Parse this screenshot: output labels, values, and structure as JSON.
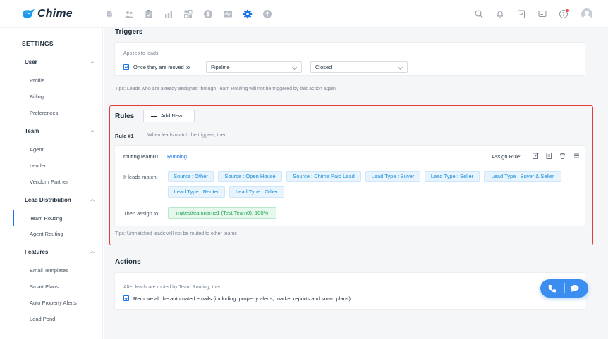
{
  "brand": {
    "name": "Chime",
    "color": "#1a9bf0"
  },
  "top_nav": {
    "icons": [
      "bell-alert-icon",
      "people-icon",
      "clipboard-check-icon",
      "bar-chart-icon",
      "grid-layout-icon",
      "dollar-icon",
      "pulse-monitor-icon",
      "gear-icon",
      "upload-circle-icon"
    ],
    "active_icon": "gear-icon",
    "accent": "#1a73e8"
  },
  "top_right": {
    "icons": [
      "search-icon",
      "bell-icon",
      "task-check-icon",
      "message-icon",
      "help-icon",
      "avatar"
    ]
  },
  "sidebar": {
    "title": "SETTINGS",
    "groups": [
      {
        "label": "User",
        "items": [
          "Profile",
          "Billing",
          "Preferences"
        ]
      },
      {
        "label": "Team",
        "items": [
          "Agent",
          "Lender",
          "Vendor / Partner"
        ]
      },
      {
        "label": "Lead Distribution",
        "items": [
          "Team Routing",
          "Agent Routing"
        ]
      },
      {
        "label": "Features",
        "items": [
          "Email Templates",
          "Smart Plans",
          "Auto Property Alerts",
          "Lead Pond"
        ]
      }
    ],
    "active_item": "Team Routing"
  },
  "triggers": {
    "title": "Triggers",
    "applies_label": "Applies to leads:",
    "checkbox_label": "Once they are moved to",
    "select_1": "Pipeline",
    "select_2": "Closed",
    "tip": "Tips: Leads who are already assigned through Team Routing will not be triggered by this action again"
  },
  "rules": {
    "title": "Rules",
    "add_label": "Add New",
    "rule_label": "Rule #1",
    "rule_desc": "When leads match the triggers, then:",
    "routing_name": "routing team01",
    "routing_status": "Running",
    "assign_rule_label": "Assign Rule:",
    "match_label": "If leads match:",
    "tags": [
      "Source : Other",
      "Source : Open House",
      "Source : Chime Paid Lead",
      "Lead Type : Buyer",
      "Lead Type : Seller",
      "Lead Type : Buyer & Seller",
      "Lead Type : Renter",
      "Lead Type : Other"
    ],
    "assign_label": "Then assign to:",
    "assignee": "mytestteamname1 (Test Team0): 100%",
    "tip": "Tips: Unmatched leads will not be routed to other teams"
  },
  "actions": {
    "title": "Actions",
    "desc": "After leads are routed by Team Routing, then:",
    "checkbox_label": "Remove all the automated emails (including: property alerts, market reports and smart plans)"
  },
  "colors": {
    "highlight_border": "#e63a3a",
    "tag_blue": "#1a8fd8",
    "tag_green": "#23a35a",
    "float_button": "#3b8ef0"
  }
}
